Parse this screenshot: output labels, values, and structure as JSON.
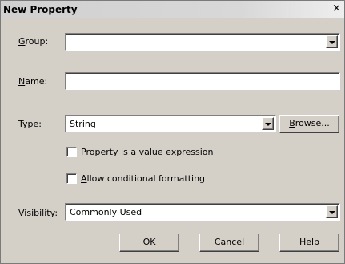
{
  "window": {
    "title": "New Property",
    "close_glyph": "×"
  },
  "fields": {
    "group": {
      "label_first": "G",
      "label_rest": "roup:",
      "value": ""
    },
    "name": {
      "label_first": "N",
      "label_rest": "ame:",
      "value": ""
    },
    "type": {
      "label_first": "T",
      "label_rest": "ype:",
      "value": "String"
    },
    "visibility": {
      "label_first": "V",
      "label_rest": "isibility:",
      "value": "Commonly Used"
    }
  },
  "checkboxes": {
    "value_expression": {
      "label_first": "P",
      "label_rest": "roperty is a value expression",
      "checked": false
    },
    "conditional_formatting": {
      "label_first": "A",
      "label_rest": "llow conditional formatting",
      "checked": false
    }
  },
  "buttons": {
    "browse_first": "B",
    "browse_rest": "rowse...",
    "ok": "OK",
    "cancel": "Cancel",
    "help": "Help"
  },
  "icons": {
    "close": "close-icon",
    "dropdown": "chevron-down-icon"
  },
  "colors": {
    "dialog_bg": "#d4d0c8",
    "field_bg": "#ffffff"
  }
}
